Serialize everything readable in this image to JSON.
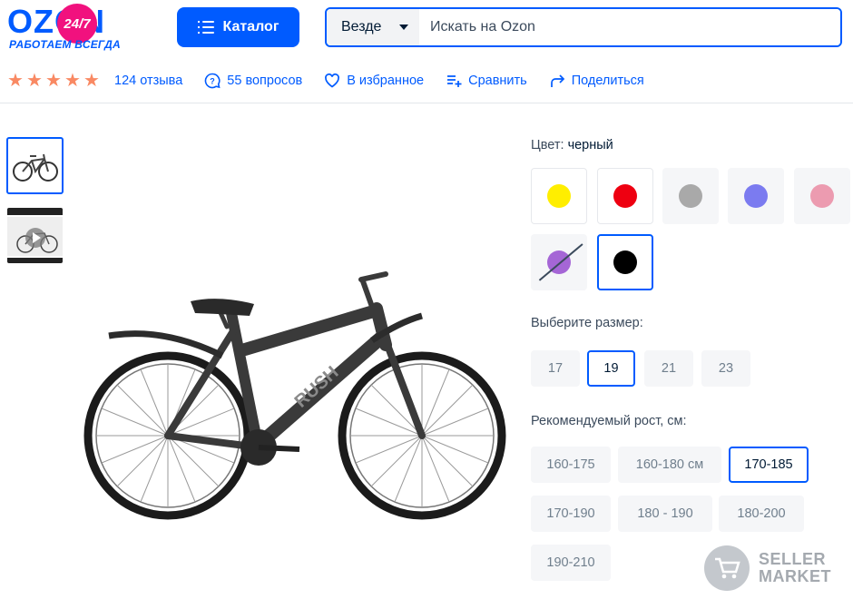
{
  "header": {
    "logo_text": "OZON",
    "logo_badge": "24/7",
    "logo_tagline": "РАБОТАЕМ ВСЕГДА",
    "catalog_label": "Каталог",
    "search_scope": "Везде",
    "search_placeholder": "Искать на Ozon"
  },
  "actions": {
    "rating_stars": 5,
    "reviews": "124 отзыва",
    "questions": "55 вопросов",
    "favorite": "В избранное",
    "compare": "Сравнить",
    "share": "Поделиться"
  },
  "color": {
    "label": "Цвет:",
    "value": "черный",
    "swatches": [
      {
        "name": "yellow",
        "hex": "#ffee00",
        "available": true,
        "selected": false
      },
      {
        "name": "red",
        "hex": "#ee0011",
        "available": true,
        "selected": false
      },
      {
        "name": "gray",
        "hex": "#a9a9a9",
        "available": true,
        "selected": false
      },
      {
        "name": "blue",
        "hex": "#7b7bf0",
        "available": true,
        "selected": false
      },
      {
        "name": "pink",
        "hex": "#ec9bb0",
        "available": true,
        "selected": false
      },
      {
        "name": "purple",
        "hex": "#a566d6",
        "available": false,
        "selected": false
      },
      {
        "name": "black",
        "hex": "#000000",
        "available": true,
        "selected": true
      }
    ]
  },
  "size": {
    "label": "Выберите размер:",
    "options": [
      "17",
      "19",
      "21",
      "23"
    ],
    "selected": "19"
  },
  "height": {
    "label": "Рекомендуемый рост, см:",
    "options": [
      "160-175",
      "160-180 см",
      "170-185",
      "170-190",
      "180 - 190",
      "180-200",
      "190-210"
    ],
    "selected": "170-185"
  },
  "watermark": {
    "line1": "SELLER",
    "line2": "MARKET"
  },
  "colors": {
    "accent": "#005bff",
    "brand_pink": "#f1117e",
    "star": "#f98963"
  }
}
